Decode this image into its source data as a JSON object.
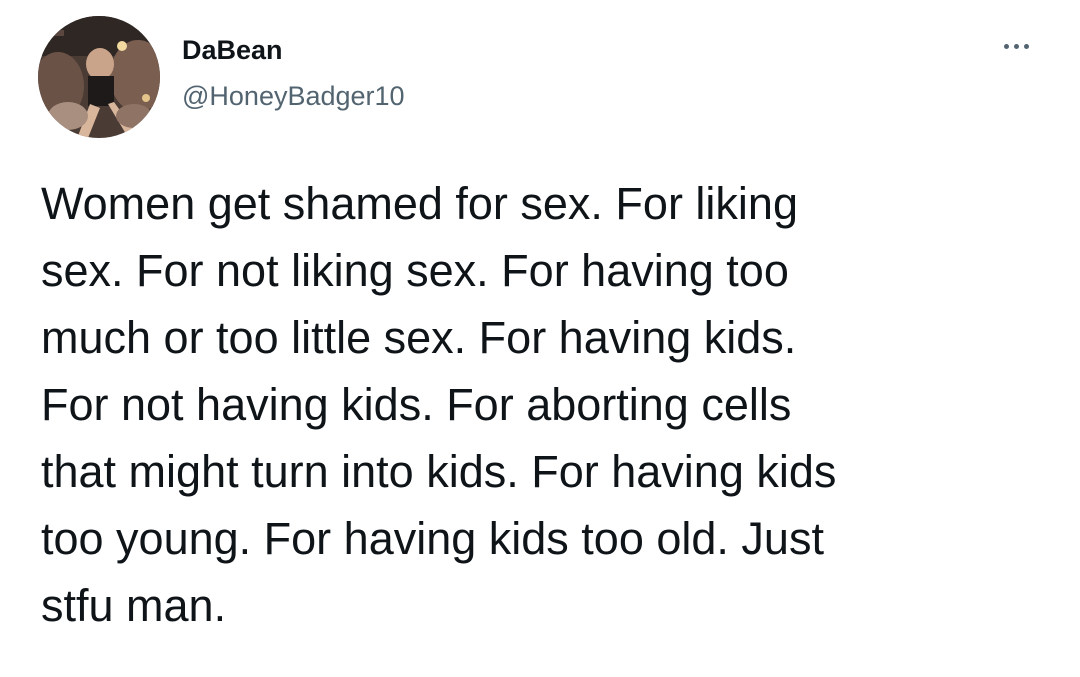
{
  "author": {
    "display_name": "DaBean",
    "handle": "@HoneyBadger10",
    "avatar_icon": "profile-photo"
  },
  "menu": {
    "more_icon": "more-horizontal-icon"
  },
  "tweet": {
    "text_lines": [
      "Women get shamed for sex. For liking",
      "sex. For not liking sex. For having too",
      "much or too little sex. For having kids.",
      "For not having kids. For aborting cells",
      "that might turn into kids. For having kids",
      "too young. For having kids too old. Just",
      "stfu man."
    ]
  },
  "colors": {
    "text_primary": "#0f1419",
    "text_secondary": "#536471",
    "background": "#ffffff"
  }
}
